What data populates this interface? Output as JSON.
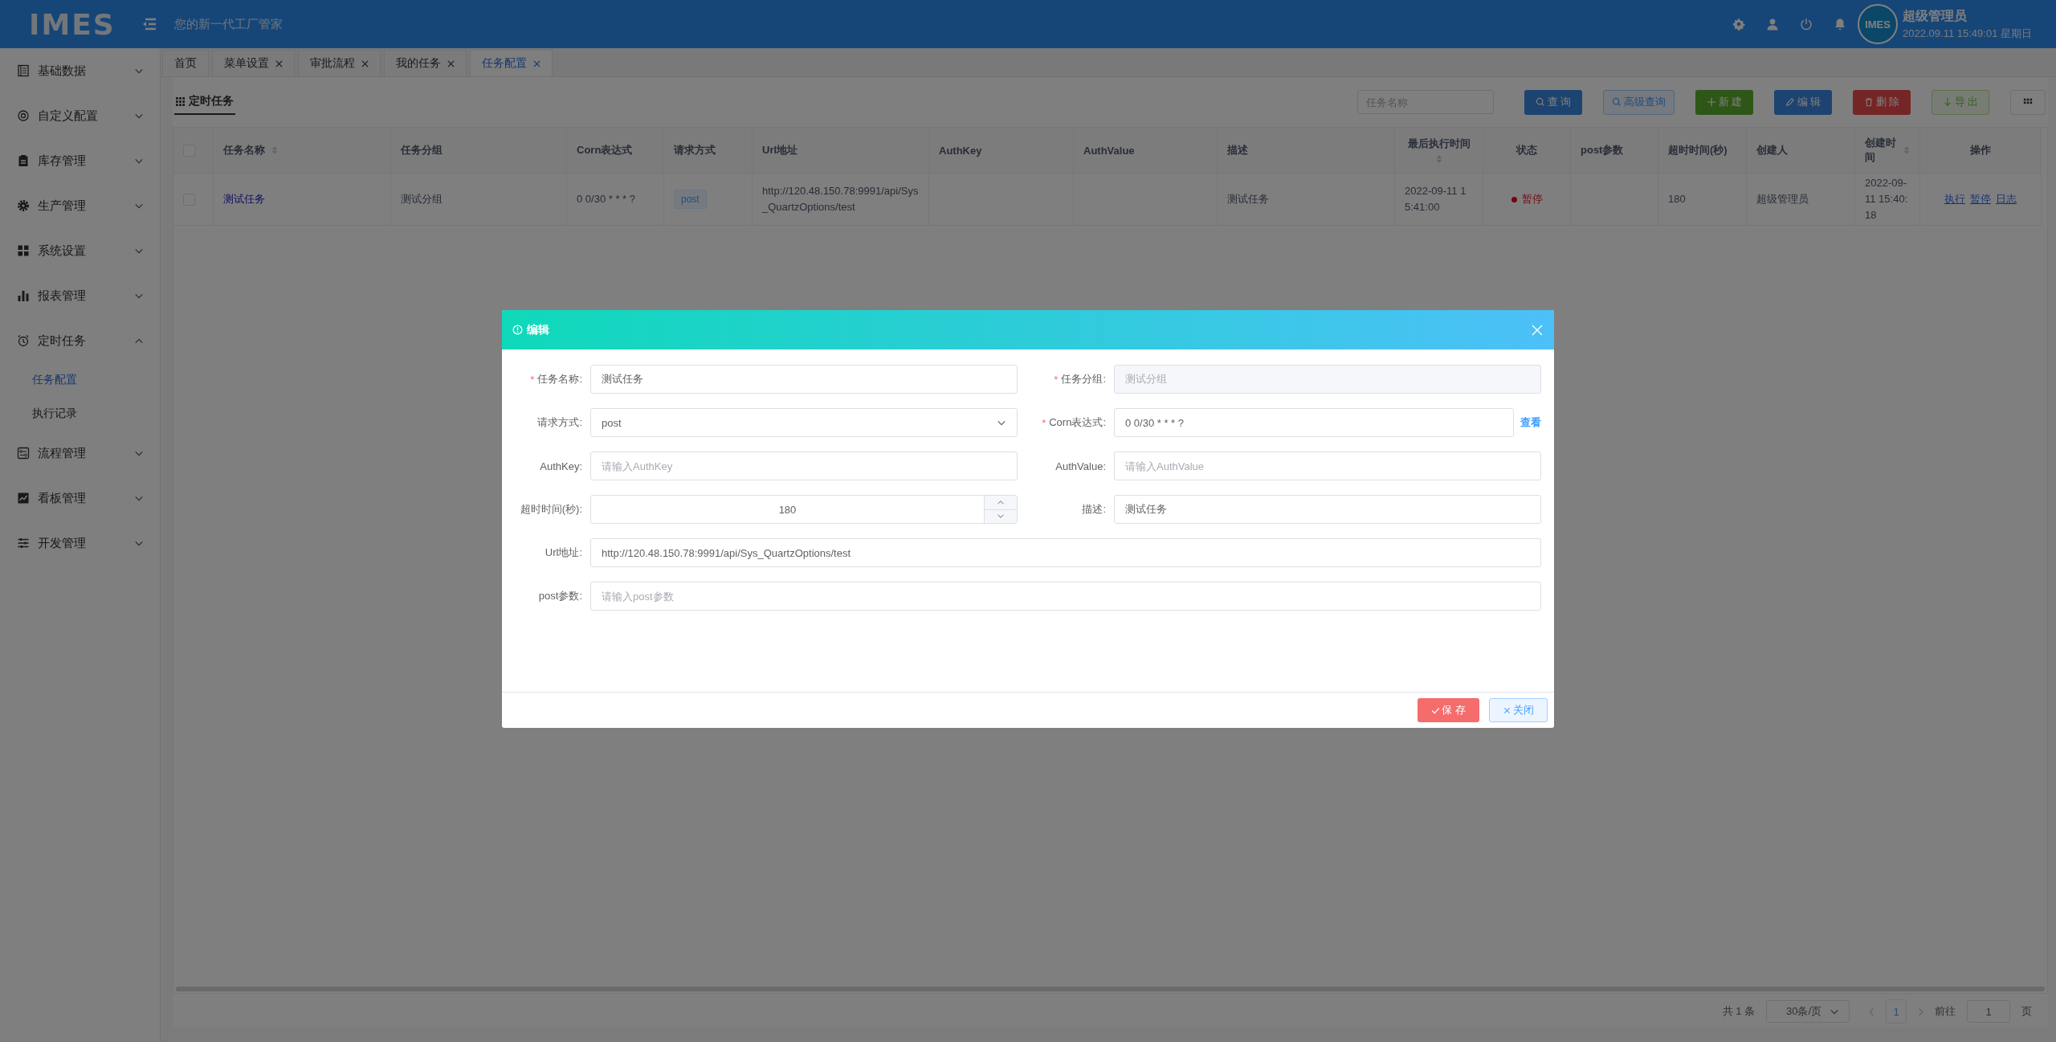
{
  "header": {
    "logo": "IMES",
    "slogan": "您的新一代工厂管家",
    "avatar_text": "IMES",
    "user_name": "超级管理员",
    "datetime": "2022.09.11 15:49:01 星期日"
  },
  "sidebar": {
    "items": [
      {
        "label": "基础数据",
        "expanded": false
      },
      {
        "label": "自定义配置",
        "expanded": false
      },
      {
        "label": "库存管理",
        "expanded": false
      },
      {
        "label": "生产管理",
        "expanded": false
      },
      {
        "label": "系统设置",
        "expanded": false
      },
      {
        "label": "报表管理",
        "expanded": false
      },
      {
        "label": "定时任务",
        "expanded": true,
        "children": [
          {
            "label": "任务配置",
            "selected": true
          },
          {
            "label": "执行记录",
            "selected": false
          }
        ]
      },
      {
        "label": "流程管理",
        "expanded": false
      },
      {
        "label": "看板管理",
        "expanded": false
      },
      {
        "label": "开发管理",
        "expanded": false
      }
    ]
  },
  "tabs": [
    {
      "label": "首页",
      "selected": false,
      "closable": false
    },
    {
      "label": "菜单设置",
      "selected": false,
      "closable": true
    },
    {
      "label": "审批流程",
      "selected": false,
      "closable": true
    },
    {
      "label": "我的任务",
      "selected": false,
      "closable": true
    },
    {
      "label": "任务配置",
      "selected": true,
      "closable": true
    }
  ],
  "panel_title": "定时任务",
  "toolbar": {
    "search": {
      "placeholder": "任务名称"
    },
    "buttons": [
      {
        "kind": "query",
        "label": "查 询"
      },
      {
        "kind": "advanced",
        "label": "高级查询"
      },
      {
        "kind": "new",
        "label": "新 建"
      },
      {
        "kind": "edit",
        "label": "编 辑"
      },
      {
        "kind": "delete",
        "label": "删 除"
      },
      {
        "kind": "export",
        "label": "导 出"
      },
      {
        "kind": "columns"
      }
    ]
  },
  "table": {
    "select_all_checked": false,
    "columns": [
      {
        "title": "任务名称",
        "sortable": true
      },
      {
        "title": "任务分组",
        "sortable": false
      },
      {
        "title": "Corn表达式",
        "sortable": false
      },
      {
        "title": "请求方式",
        "sortable": false
      },
      {
        "title": "Url地址",
        "sortable": false
      },
      {
        "title": "AuthKey",
        "sortable": false
      },
      {
        "title": "AuthValue",
        "sortable": false
      },
      {
        "title": "描述",
        "sortable": false
      },
      {
        "title": "最后执行时间",
        "sortable": true
      },
      {
        "title": "状态",
        "sortable": false
      },
      {
        "title": "post参数",
        "sortable": false
      },
      {
        "title": "超时时间(秒)",
        "sortable": false
      },
      {
        "title": "创建人",
        "sortable": false
      },
      {
        "title": "创建时间",
        "sortable": true
      },
      {
        "title": "操作",
        "sortable": false
      }
    ],
    "rows": [
      {
        "checked": false,
        "cells": [
          {
            "kind": "link",
            "text": "测试任务"
          },
          {
            "kind": "text",
            "text": "测试分组"
          },
          {
            "kind": "text",
            "text": "0 0/30 * * * ?"
          },
          {
            "kind": "tag",
            "text": "post"
          },
          {
            "kind": "text",
            "text": "http://120.48.150.78:9991/api/Sys_QuartzOptions/test"
          },
          {
            "kind": "empty"
          },
          {
            "kind": "empty"
          },
          {
            "kind": "text",
            "text": "测试任务"
          },
          {
            "kind": "text",
            "text": "2022-09-11 15:41:00"
          },
          {
            "kind": "status",
            "text": "暂停"
          },
          {
            "kind": "empty"
          },
          {
            "kind": "text",
            "text": "180"
          },
          {
            "kind": "text",
            "text": "超级管理员"
          },
          {
            "kind": "text",
            "text": "2022-09-11 15:40:18"
          },
          {
            "kind": "actions",
            "links": [
              "执行",
              "暂停",
              "日志"
            ]
          }
        ]
      }
    ]
  },
  "pagination": {
    "total": "共 1 条",
    "page_size": "30条/页",
    "pages": [
      {
        "label": "1",
        "selected": true
      }
    ],
    "goto_label": "前往",
    "goto_value": "1",
    "goto_suffix": "页"
  },
  "dialog": {
    "title": "编辑",
    "fields": [
      {
        "label": "任务名称:",
        "required_mark": "*",
        "kind": "text",
        "value": "测试任务"
      },
      {
        "label": "任务分组:",
        "required_mark": "*",
        "kind": "disabled",
        "value": "测试分组"
      },
      {
        "label": "请求方式:",
        "kind": "select",
        "value": "post"
      },
      {
        "label": "Corn表达式:",
        "required_mark": "*",
        "kind": "text",
        "value": "0 0/30 * * * ?",
        "link": "查看"
      },
      {
        "label": "AuthKey:",
        "kind": "text",
        "placeholder": "请输入AuthKey"
      },
      {
        "label": "AuthValue:",
        "kind": "text",
        "placeholder": "请输入AuthValue"
      },
      {
        "label": "超时时间(秒):",
        "kind": "number",
        "value": "180"
      },
      {
        "label": "描述:",
        "kind": "text",
        "value": "测试任务"
      },
      {
        "label": "Url地址:",
        "kind": "wide",
        "value": "http://120.48.150.78:9991/api/Sys_QuartzOptions/test"
      },
      {
        "label": "post参数:",
        "kind": "wide",
        "placeholder": "请输入post参数"
      }
    ],
    "buttons": [
      {
        "kind": "save",
        "label": "保 存"
      },
      {
        "kind": "close",
        "label": "关闭"
      }
    ]
  }
}
